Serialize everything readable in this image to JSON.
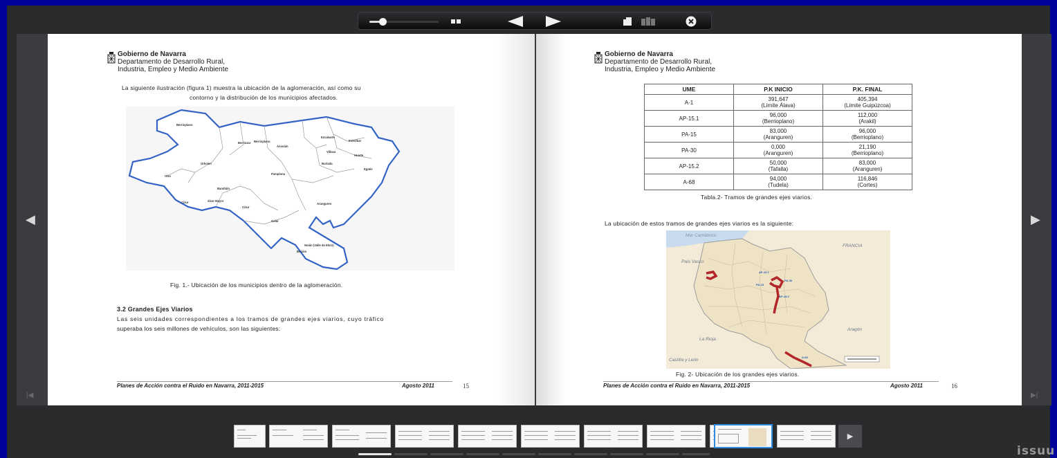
{
  "toolbar": {
    "zoom_level": 0.15,
    "icons": [
      "zoom-slider",
      "single-page-view-icon",
      "previous-arrow-icon",
      "next-arrow-icon",
      "fullscreen-icon",
      "grid-view-icon",
      "close-icon"
    ]
  },
  "header": {
    "org": "Gobierno de Navarra",
    "dept_line1": "Departamento de Desarrollo Rural,",
    "dept_line2": "Industria, Empleo y Medio Ambiente"
  },
  "left_page": {
    "intro_line1": "La siguiente ilustración (figura 1) muestra la ubicación de la aglomeración, así como su",
    "intro_line2": "contorno y la distribución de los municipios afectados.",
    "map_labels": [
      "Berrioplano",
      "Berriozar",
      "Berrioplano",
      "Ansoáin",
      "Ezcabarte",
      "Esteribar",
      "Villava",
      "Huarte",
      "Burlada",
      "Egüés",
      "Orkoien",
      "Pamplona",
      "Olza",
      "Barañáin",
      "Cizur",
      "Zizur Mayor",
      "Cizur",
      "Galar",
      "Aranguren",
      "Noáin (Valle de Elorz)",
      "Beriáin"
    ],
    "figure_caption": "Fig. 1.- Ubicación de los municipios dentro de la aglomeración.",
    "section_title": "3.2 Grandes Ejes Viarios",
    "body_line1": "Las seis unidades correspondientes a los tramos de grandes ejes viarios, cuyo tráfico",
    "body_line2": "superaba los seis millones de vehículos, son las siguientes:",
    "footer_title": "Planes de Acción contra el Ruido en Navarra, 2011-2015",
    "footer_date": "Agosto 2011",
    "page_number": "15"
  },
  "right_page": {
    "table": {
      "headers": [
        "UME",
        "P.K INICIO",
        "P.K. FINAL"
      ],
      "rows": [
        [
          "A-1",
          "391,647",
          "(Límite Álava)",
          "405,394",
          "(Límite Guipúzcoa)"
        ],
        [
          "AP-15.1",
          "96,000",
          "(Berrioplano)",
          "112,000",
          "(Arakil)"
        ],
        [
          "PA-15",
          "83,000",
          "(Aranguren)",
          "96,000",
          "(Berrioplano)"
        ],
        [
          "PA-30",
          "0,000",
          "(Aranguren)",
          "21,190",
          "(Berrioplano)"
        ],
        [
          "AP-15.2",
          "50,000",
          "(Tafalla)",
          "83,000",
          "(Aranguren)"
        ],
        [
          "A-68",
          "94,000",
          "(Tudela)",
          "116,846",
          "(Cortes)"
        ]
      ],
      "caption": "Tabla.2- Tramos  de grandes ejes viarios."
    },
    "intro": "La ubicación de estos tramos de grandes ejes viarios es la siguiente:",
    "map_labels": {
      "sea": "Mar Cantábrico",
      "france": "FRANCIA",
      "basque": "País Vasco",
      "aragon": "Aragón",
      "rioja": "La Rioja",
      "castilla": "Castilla y León"
    },
    "road_tags": [
      "AP-15.1",
      "PA-30",
      "PA-15",
      "AP-15.2",
      "A-68"
    ],
    "figure_caption": "Fig. 2- Ubicación de los grandes ejes viarios.",
    "footer_title": "Planes de Acción contra el Ruido en Navarra, 2011-2015",
    "footer_date": "Agosto 2011",
    "page_number": "16"
  },
  "thumbnails": {
    "count": 10,
    "selected_index": 8
  },
  "progress": {
    "segments": 10,
    "active_index": 0
  },
  "brand": "issuu"
}
